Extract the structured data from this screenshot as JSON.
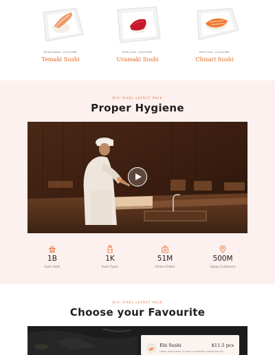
{
  "sushi_cards": [
    {
      "kicker": "Seasonal Cuisine",
      "name": "Temaki Sushi"
    },
    {
      "kicker": "Special Cuisine",
      "name": "Uramaki Sushi"
    },
    {
      "kicker": "Special Cuisine",
      "name": "Chisari Sushi"
    }
  ],
  "hygiene": {
    "kicker": "Divi Pixel Layout Pack",
    "title": "Proper Hygiene",
    "video_play_icon": "play-icon",
    "stats": [
      {
        "icon": "house-icon",
        "value": "1B",
        "label": "Sushi Sells"
      },
      {
        "icon": "bottle-icon",
        "value": "1K",
        "label": "Sushi Types"
      },
      {
        "icon": "bag-icon",
        "value": "51M",
        "label": "Online Orders"
      },
      {
        "icon": "location-pin-icon",
        "value": "500M",
        "label": "Happy Customers"
      }
    ]
  },
  "favourite": {
    "kicker": "Divi Pixel Layout Pack",
    "title": "Choose your Favourite",
    "menu_item": {
      "name": "Ebi Sushi",
      "price": "$11.5 pcs",
      "description": "Lorem ipsum dolor sit amet consectetur adipiscing elit"
    }
  },
  "colors": {
    "accent": "#e0651f",
    "section_bg": "#fcf1ee",
    "text": "#1f1f1f"
  }
}
